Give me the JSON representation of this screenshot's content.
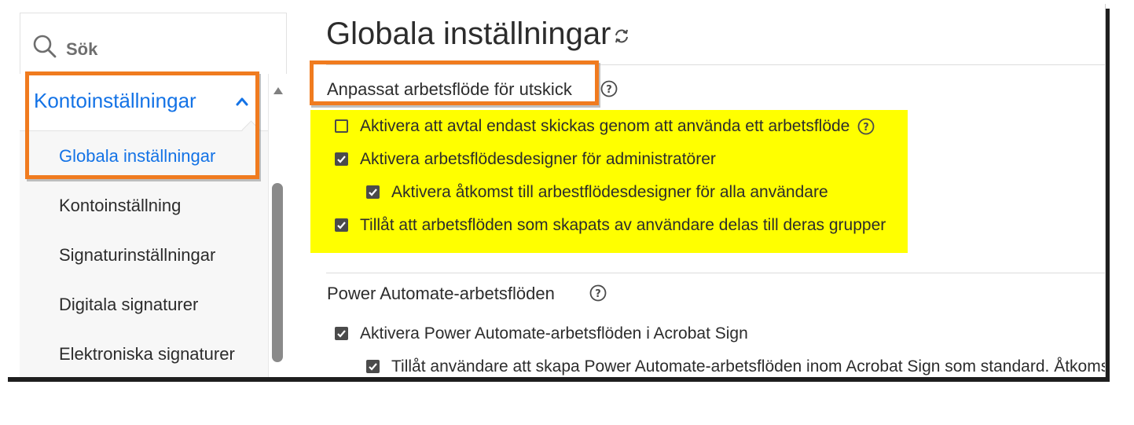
{
  "sidebar": {
    "search_placeholder": "Sök",
    "group_label": "Kontoinställningar",
    "items": [
      {
        "label": "Globala inställningar"
      },
      {
        "label": "Kontoinställning"
      },
      {
        "label": "Signaturinställningar"
      },
      {
        "label": "Digitala signaturer"
      },
      {
        "label": "Elektroniska signaturer"
      }
    ]
  },
  "main": {
    "title": "Globala inställningar",
    "sections": [
      {
        "title": "Anpassat arbetsflöde för utskick",
        "options": [
          {
            "label": "Aktivera att avtal endast skickas genom att använda ett arbetsflöde",
            "checked": false
          },
          {
            "label": "Aktivera arbetsflödesdesigner för administratörer",
            "checked": true
          },
          {
            "label": "Aktivera åtkomst till arbestflödesdesigner för alla användare",
            "checked": true
          },
          {
            "label": "Tillåt att arbetsflöden som skapats av användare delas till deras grupper",
            "checked": true
          }
        ]
      },
      {
        "title": "Power Automate-arbetsflöden",
        "options": [
          {
            "label": "Aktivera Power Automate-arbetsflöden i Acrobat Sign",
            "checked": true
          },
          {
            "label": "Tillåt användare att skapa Power Automate-arbetsflöden inom Acrobat Sign som standard. Åtkomst",
            "checked": true
          }
        ]
      }
    ]
  },
  "colors": {
    "accent": "#1473e6",
    "annotation_box": "#f07b1f",
    "highlight": "#ffff00"
  }
}
